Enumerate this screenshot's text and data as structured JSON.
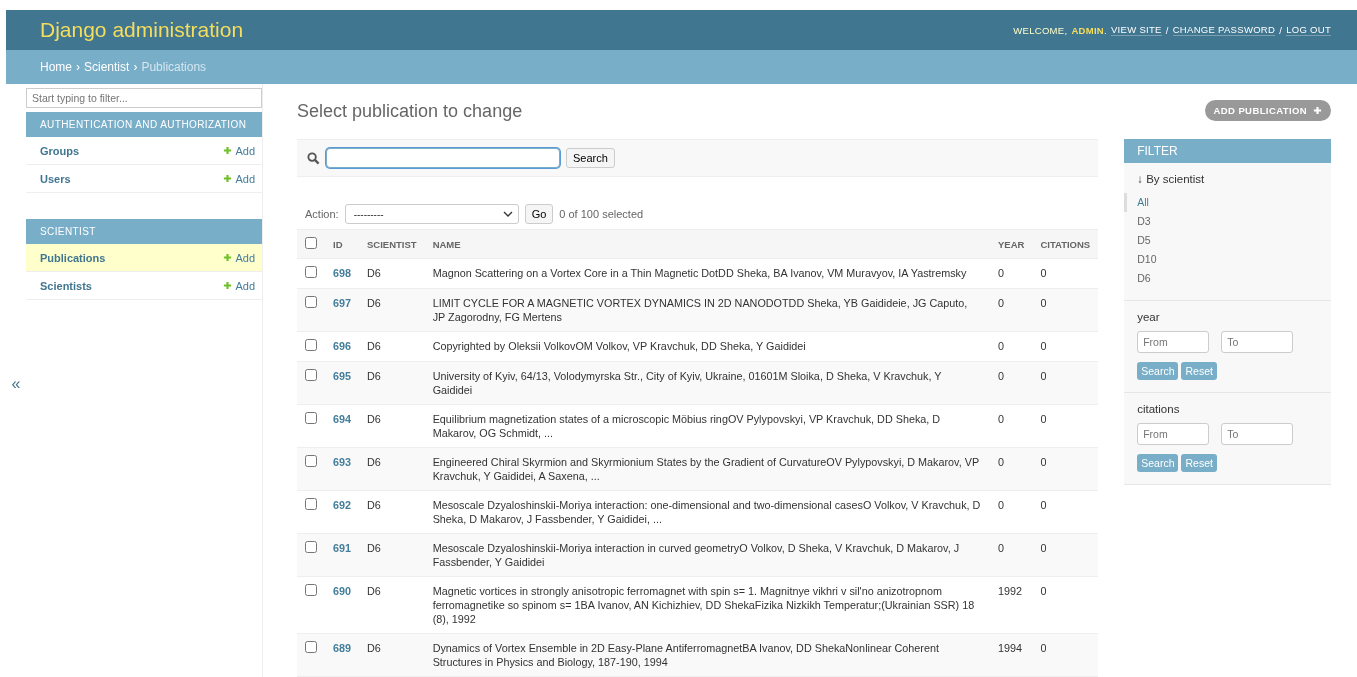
{
  "header": {
    "title": "Django administration",
    "welcome": "WELCOME,",
    "user": "ADMIN",
    "user_end": ".",
    "links": [
      "VIEW SITE",
      "CHANGE PASSWORD",
      "LOG OUT"
    ],
    "separator": "/"
  },
  "breadcrumbs": {
    "items": [
      "Home",
      "Scientist"
    ],
    "current": "Publications",
    "separator": "›"
  },
  "sidebar": {
    "filter_placeholder": "Start typing to filter...",
    "collapse": "«",
    "modules": [
      {
        "title": "AUTHENTICATION AND AUTHORIZATION",
        "models": [
          {
            "name": "Groups",
            "add": "Add",
            "selected": false
          },
          {
            "name": "Users",
            "add": "Add",
            "selected": false
          }
        ]
      },
      {
        "title": "SCIENTIST",
        "models": [
          {
            "name": "Publications",
            "add": "Add",
            "selected": true
          },
          {
            "name": "Scientists",
            "add": "Add",
            "selected": false
          }
        ]
      }
    ]
  },
  "page_title": "Select publication to change",
  "add_button": "ADD PUBLICATION",
  "search": {
    "button": "Search"
  },
  "actions": {
    "label": "Action:",
    "value": "---------",
    "go": "Go",
    "counter": "0 of 100 selected"
  },
  "table": {
    "all_checked": false,
    "columns": [
      "ID",
      "SCIENTIST",
      "NAME",
      "YEAR",
      "CITATIONS"
    ],
    "rows": [
      {
        "id": "698",
        "scientist": "D6",
        "name": "Magnon Scattering on a Vortex Core in a Thin Magnetic DotDD Sheka, BA Ivanov, VM Muravyov, IA Yastremsky",
        "year": "0",
        "citations": "0",
        "checked": false
      },
      {
        "id": "697",
        "scientist": "D6",
        "name": "LIMIT CYCLE FOR A MAGNETIC VORTEX DYNAMICS IN 2D NANODOTDD Sheka, YB Gaidideie, JG Caputo, JP Zagorodny, FG Mertens",
        "year": "0",
        "citations": "0",
        "checked": false
      },
      {
        "id": "696",
        "scientist": "D6",
        "name": "Copyrighted by Oleksii VolkovOM Volkov, VP Kravchuk, DD Sheka, Y Gaididei",
        "year": "0",
        "citations": "0",
        "checked": false
      },
      {
        "id": "695",
        "scientist": "D6",
        "name": "University of Kyiv, 64/13, Volodymyrska Str., City of Kyiv, Ukraine, 01601M Sloika, D Sheka, V Kravchuk, Y Gaididei",
        "year": "0",
        "citations": "0",
        "checked": false
      },
      {
        "id": "694",
        "scientist": "D6",
        "name": "Equilibrium magnetization states of a microscopic Möbius ringOV Pylypovskyi, VP Kravchuk, DD Sheka, D Makarov, OG Schmidt, ...",
        "year": "0",
        "citations": "0",
        "checked": false
      },
      {
        "id": "693",
        "scientist": "D6",
        "name": "Engineered Chiral Skyrmion and Skyrmionium States by the Gradient of CurvatureOV Pylypovskyi, D Makarov, VP Kravchuk, Y Gaididei, A Saxena, ...",
        "year": "0",
        "citations": "0",
        "checked": false
      },
      {
        "id": "692",
        "scientist": "D6",
        "name": "Mesoscale Dzyaloshinskii-Moriya interaction: one-dimensional and two-dimensional casesO Volkov, V Kravchuk, D Sheka, D Makarov, J Fassbender, Y Gaididei, ...",
        "year": "0",
        "citations": "0",
        "checked": false
      },
      {
        "id": "691",
        "scientist": "D6",
        "name": "Mesoscale Dzyaloshinskii-Moriya interaction in curved geometryO Volkov, D Sheka, V Kravchuk, D Makarov, J Fassbender, Y Gaididei",
        "year": "0",
        "citations": "0",
        "checked": false
      },
      {
        "id": "690",
        "scientist": "D6",
        "name": "Magnetic vortices in strongly anisotropic ferromagnet with spin s= 1. Magnitnye vikhri v sil'no anizotropnom ferromagnetike so spinom s= 1BA Ivanov, AN Kichizhiev, DD ShekaFizika Nizkikh Temperatur;(Ukrainian SSR) 18 (8), 1992",
        "year": "1992",
        "citations": "0",
        "checked": false
      },
      {
        "id": "689",
        "scientist": "D6",
        "name": "Dynamics of Vortex Ensemble in 2D Easy-Plane AntiferromagnetBA Ivanov, DD ShekaNonlinear Coherent Structures in Physics and Biology, 187-190, 1994",
        "year": "1994",
        "citations": "0",
        "checked": false
      }
    ]
  },
  "filter": {
    "title": "FILTER",
    "by_scientist": {
      "title": "By scientist",
      "arrow": "↓",
      "options": [
        {
          "label": "All",
          "selected": true
        },
        {
          "label": "D3",
          "selected": false
        },
        {
          "label": "D5",
          "selected": false
        },
        {
          "label": "D10",
          "selected": false
        },
        {
          "label": "D6",
          "selected": false
        }
      ]
    },
    "ranges": [
      {
        "title": "year",
        "from": {
          "placeholder": "From"
        },
        "to": {
          "placeholder": "To"
        },
        "search": "Search",
        "reset": "Reset"
      },
      {
        "title": "citations",
        "from": {
          "placeholder": "From"
        },
        "to": {
          "placeholder": "To"
        },
        "search": "Search",
        "reset": "Reset"
      }
    ]
  }
}
